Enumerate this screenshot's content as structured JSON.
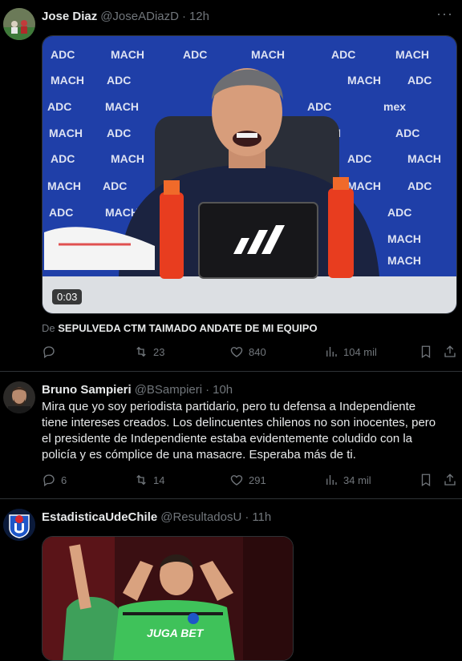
{
  "tweets": [
    {
      "name": "Jose Diaz",
      "handle": "@JoseADiazD",
      "time": "12h",
      "video_duration": "0:03",
      "source_prefix": "De",
      "source_title": "SEPULVEDA CTM TAIMADO ANDATE DE MI EQUIPO",
      "replies": "",
      "retweets": "23",
      "likes": "840",
      "views": "104 mil"
    },
    {
      "name": "Bruno Sampieri",
      "handle": "@BSampieri",
      "time": "10h",
      "text": "Mira que yo soy periodista partidario, pero tu defensa a Independiente tiene intereses creados. Los delincuentes chilenos no son inocentes, pero el presidente de Independiente estaba evidentemente coludido con la policía y es cómplice de una masacre. Esperaba más de ti.",
      "replies": "6",
      "retweets": "14",
      "likes": "291",
      "views": "34 mil"
    },
    {
      "name": "EstadisticaUdeChile",
      "handle": "@ResultadosU",
      "time": "11h",
      "jersey_text": "JUGA BET"
    }
  ],
  "dot": "·",
  "video_backdrop": {
    "logo_rows": [
      [
        "ADC",
        "MACH"
      ],
      [
        "MACH"
      ],
      [
        "MACH"
      ],
      [
        "mex"
      ],
      [
        "MACH"
      ]
    ]
  },
  "colors": {
    "background": "#000000",
    "text": "#e7e9ea",
    "muted": "#71767b",
    "separator": "#2f3336",
    "backdrop_blue": "#1f3fa8"
  }
}
